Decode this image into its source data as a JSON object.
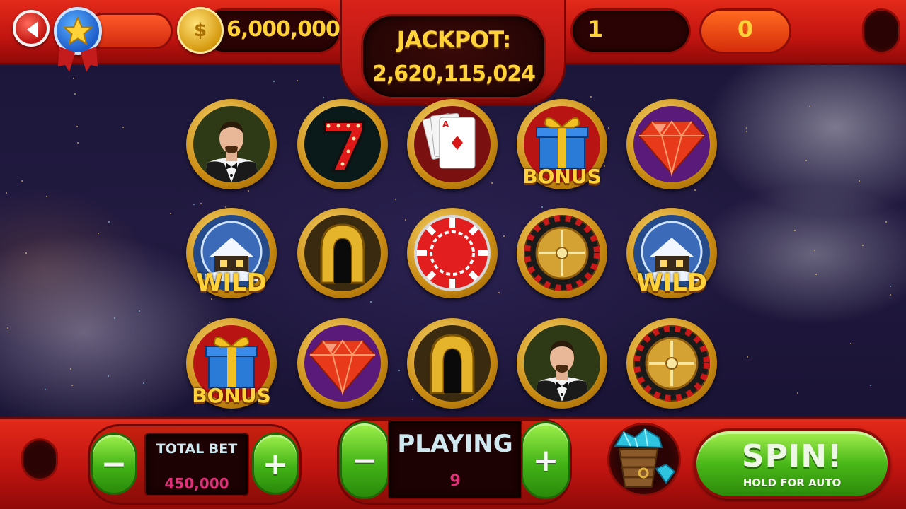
{
  "header": {
    "coins": "6,000,000",
    "coin_symbol": "$",
    "jackpot_label": "JACKPOT:",
    "jackpot_value": "2,620,115,024",
    "lines": "1",
    "win": "0"
  },
  "reels": {
    "rows": [
      [
        {
          "symbol": "dealer-icon",
          "label": ""
        },
        {
          "symbol": "seven-icon",
          "label": ""
        },
        {
          "symbol": "playing-cards-icon",
          "label": ""
        },
        {
          "symbol": "gift-box-icon",
          "label": "BONUS"
        },
        {
          "symbol": "diamond-icon",
          "label": ""
        }
      ],
      [
        {
          "symbol": "snow-cabin-icon",
          "label": "WILD"
        },
        {
          "symbol": "horseshoe-icon",
          "label": ""
        },
        {
          "symbol": "casino-chip-icon",
          "label": ""
        },
        {
          "symbol": "roulette-wheel-icon",
          "label": ""
        },
        {
          "symbol": "snow-cabin-icon",
          "label": "WILD"
        }
      ],
      [
        {
          "symbol": "gift-box-icon",
          "label": "BONUS"
        },
        {
          "symbol": "diamond-icon",
          "label": ""
        },
        {
          "symbol": "horseshoe-icon",
          "label": ""
        },
        {
          "symbol": "dealer-icon",
          "label": ""
        },
        {
          "symbol": "roulette-wheel-icon",
          "label": ""
        }
      ]
    ]
  },
  "footer": {
    "total_bet_label": "TOTAL BET",
    "total_bet_value": "450,000",
    "playing_label": "PLAYING",
    "playing_value": "9",
    "minus": "−",
    "plus": "+",
    "spin_label": "SPIN!",
    "spin_sub": "HOLD FOR AUTO"
  },
  "colors": {
    "frame_red": "#c21410",
    "gold_text": "#ffd23a",
    "button_green": "#49b818",
    "bet_value": "#e0307a"
  }
}
